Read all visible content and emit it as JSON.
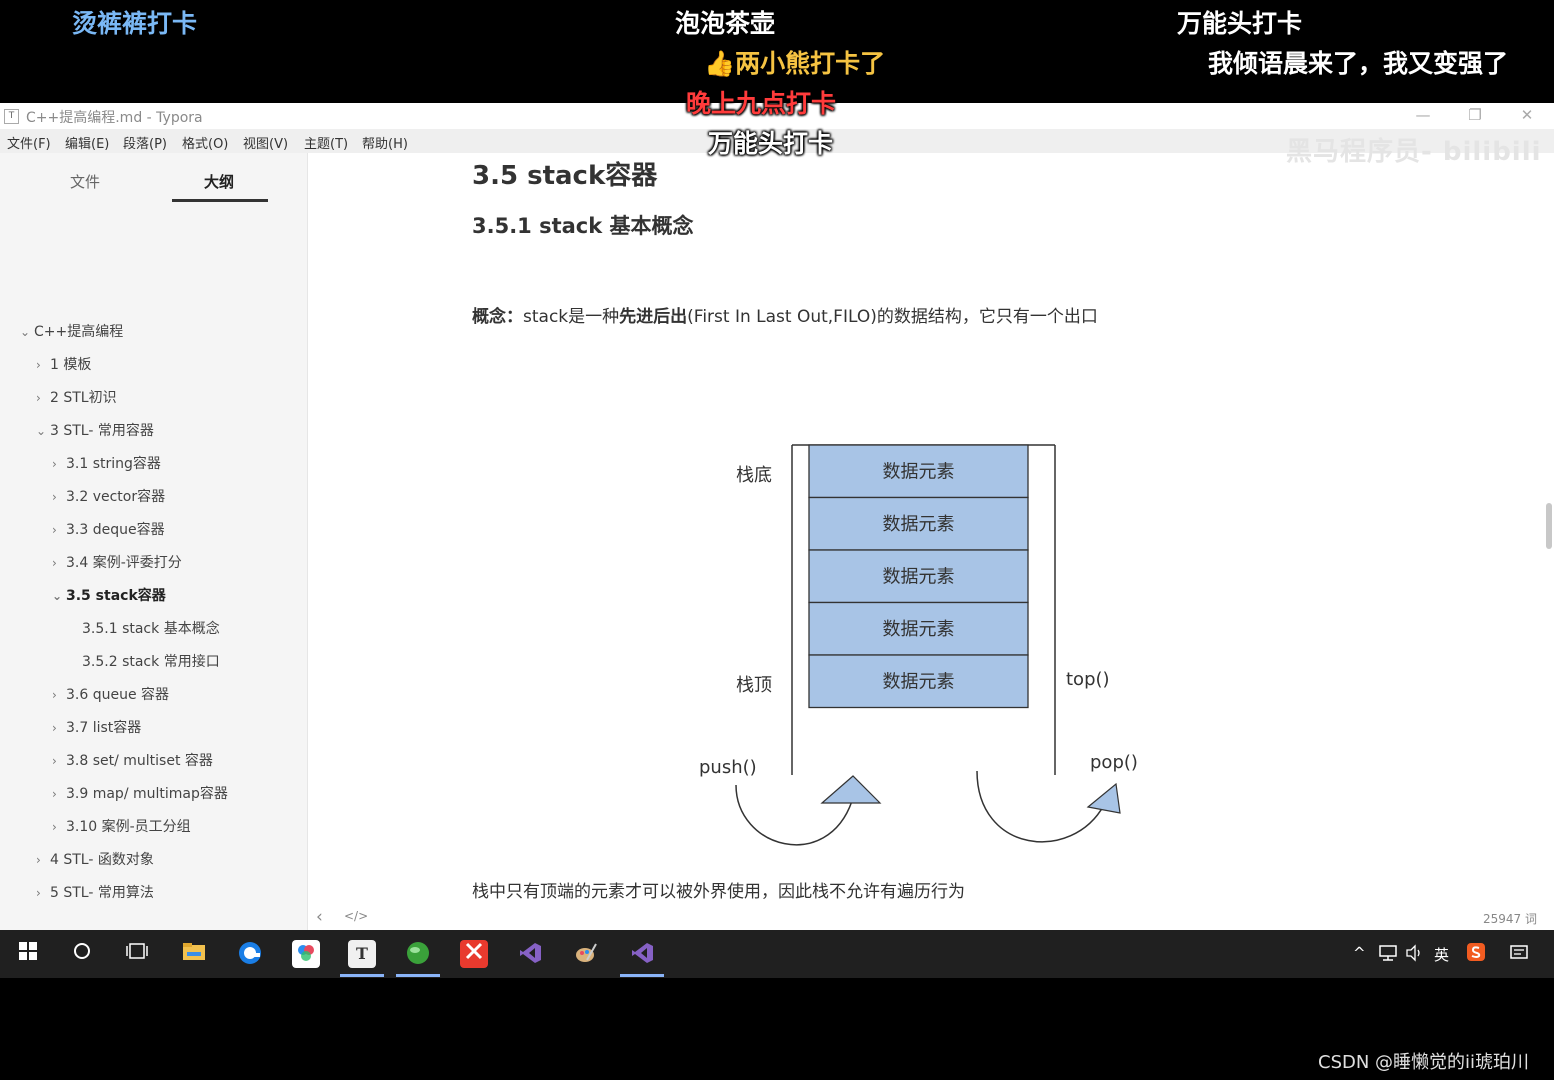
{
  "danmaku": [
    {
      "text": "烫裤裤打卡",
      "color": "#7ab8f5"
    },
    {
      "text": "泡泡茶壶",
      "color": "#ffffff"
    },
    {
      "text": "万能头打卡",
      "color": "#ffffff"
    },
    {
      "text": "两小熊打卡了",
      "color": "#f5c342"
    },
    {
      "text": "我倾语晨来了，我又变强了",
      "color": "#ffffff"
    },
    {
      "text": "晚上九点打卡",
      "color": "#ff3b3b"
    },
    {
      "text": "万能头打卡",
      "color": "#ffffff"
    }
  ],
  "window": {
    "title": "C++提高编程.md - Typora",
    "app_icon": "T",
    "controls": {
      "minimize": "—",
      "restore": "❐",
      "close": "✕"
    }
  },
  "menu": [
    "文件(F)",
    "编辑(E)",
    "段落(P)",
    "格式(O)",
    "视图(V)",
    "主题(T)",
    "帮助(H)"
  ],
  "sidebar": {
    "tabs": [
      "文件",
      "大纲"
    ],
    "active_tab": "大纲",
    "outline": [
      {
        "label": "C++提高编程",
        "level": 0,
        "state": "open",
        "bold": false
      },
      {
        "label": "1 模板",
        "level": 1,
        "state": "closed",
        "bold": false
      },
      {
        "label": "2 STL初识",
        "level": 1,
        "state": "closed",
        "bold": false
      },
      {
        "label": "3 STL- 常用容器",
        "level": 1,
        "state": "open",
        "bold": false
      },
      {
        "label": "3.1 string容器",
        "level": 2,
        "state": "closed",
        "bold": false
      },
      {
        "label": "3.2 vector容器",
        "level": 2,
        "state": "closed",
        "bold": false
      },
      {
        "label": "3.3 deque容器",
        "level": 2,
        "state": "closed",
        "bold": false
      },
      {
        "label": "3.4 案例-评委打分",
        "level": 2,
        "state": "closed",
        "bold": false
      },
      {
        "label": "3.5 stack容器",
        "level": 2,
        "state": "open",
        "bold": true
      },
      {
        "label": "3.5.1 stack 基本概念",
        "level": 3,
        "state": "none",
        "bold": false
      },
      {
        "label": "3.5.2 stack 常用接口",
        "level": 3,
        "state": "none",
        "bold": false
      },
      {
        "label": "3.6 queue 容器",
        "level": 2,
        "state": "closed",
        "bold": false
      },
      {
        "label": "3.7 list容器",
        "level": 2,
        "state": "closed",
        "bold": false
      },
      {
        "label": "3.8 set/ multiset 容器",
        "level": 2,
        "state": "closed",
        "bold": false
      },
      {
        "label": "3.9 map/ multimap容器",
        "level": 2,
        "state": "closed",
        "bold": false
      },
      {
        "label": "3.10 案例-员工分组",
        "level": 2,
        "state": "closed",
        "bold": false
      },
      {
        "label": "4 STL- 函数对象",
        "level": 1,
        "state": "closed",
        "bold": false
      },
      {
        "label": "5 STL- 常用算法",
        "level": 1,
        "state": "closed",
        "bold": false
      }
    ]
  },
  "doc": {
    "h2": "3.5 stack容器",
    "h3": "3.5.1 stack 基本概念",
    "concept_label": "概念：",
    "concept_pre": "stack是一种",
    "concept_bold": "先进后出",
    "concept_post": "(First In Last Out,FILO)的数据结构，它只有一个出口",
    "diagram": {
      "element_label": "数据元素",
      "element_count": 5,
      "bottom_label": "栈底",
      "top_label": "栈顶",
      "top_func": "top()",
      "push_func": "push()",
      "pop_func": "pop()",
      "fill_color": "#a8c4e6",
      "stroke_color": "#333333"
    },
    "footer_text": "栈中只有顶端的元素才可以被外界使用，因此栈不允许有遍历行为",
    "watermark": "黑马程序员- bilibili"
  },
  "statusbar": {
    "back_icon": "‹",
    "source_icon": "</>",
    "word_count": "25947 词"
  },
  "taskbar": {
    "tray_lang": "英",
    "tray_arrow": "^"
  },
  "csdn_watermark": "CSDN @睡懒觉的ii琥珀川"
}
